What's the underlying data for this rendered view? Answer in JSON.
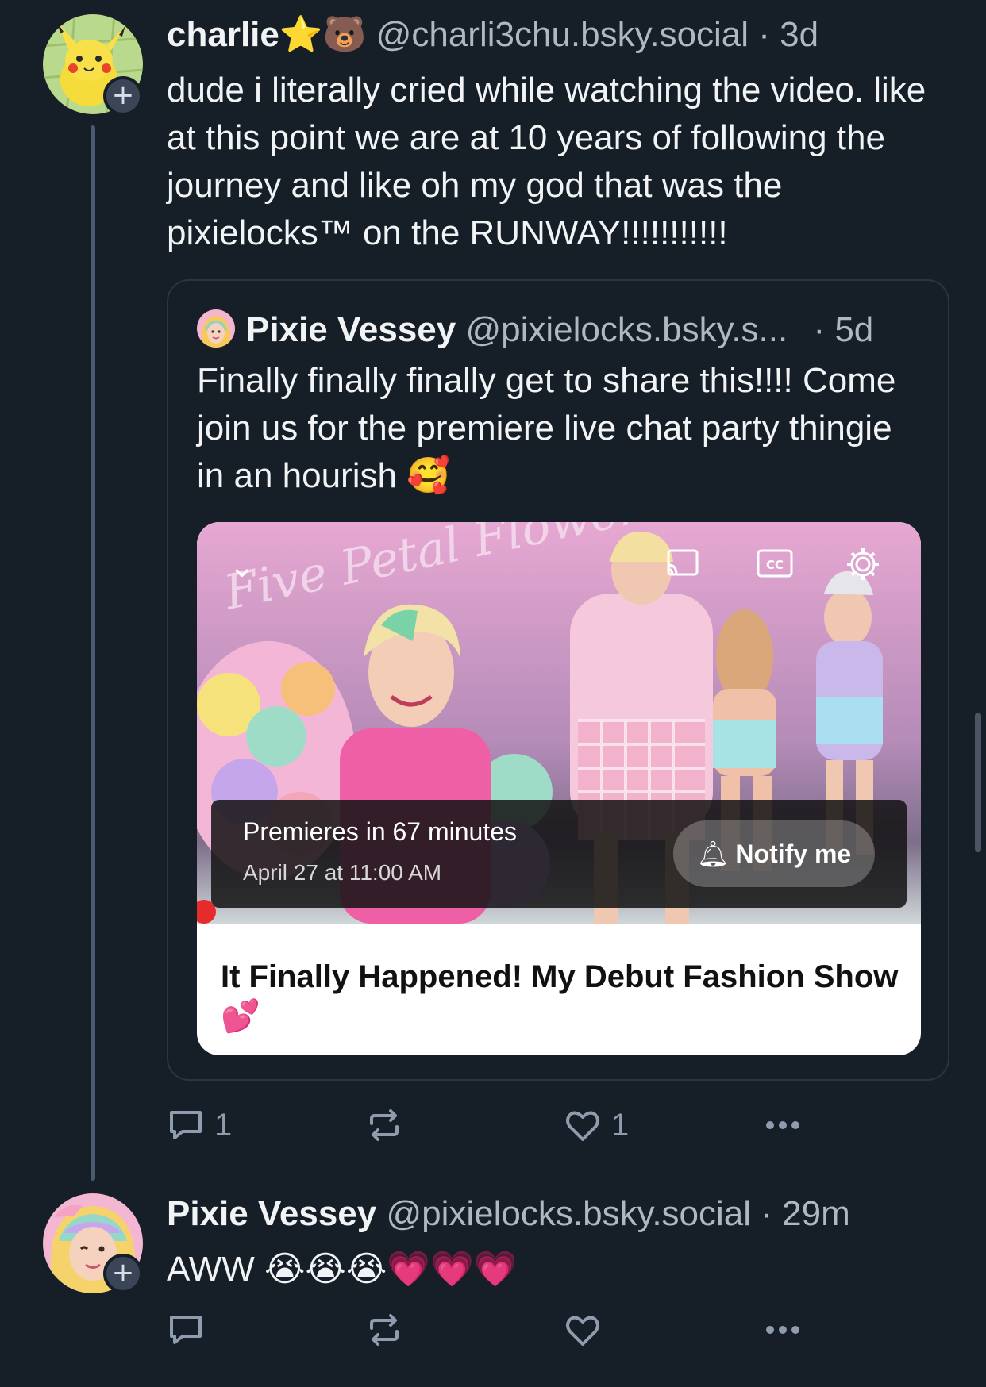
{
  "post1": {
    "display_name": "charlie",
    "name_emoji": "⭐🐻",
    "handle": "@charli3chu.bsky.social",
    "time": "· 3d",
    "text": "dude i literally cried while watching the video. like at this point we are at 10 years of following the journey and like oh my god that was the pixielocks™ on the RUNWAY!!!!!!!!!!!",
    "avatar_icon": "pikachu-avatar",
    "actions": {
      "reply_count": "1",
      "repost_count": "",
      "like_count": "1"
    }
  },
  "quote": {
    "display_name": "Pixie Vessey",
    "handle": "@pixielocks.bsky.s...",
    "time": "· 5d",
    "text": "Finally finally finally get to share this!!!! Come join us for the premiere live chat party thingie in an hourish 🥰",
    "embed": {
      "premiere_text": "Premieres in 67 minutes",
      "premiere_date": "April 27 at 11:00 AM",
      "notify_label": "Notify me",
      "video_title": "It Finally Happened! My Debut Fashion Show 💕",
      "icons": [
        "chevron-down-icon",
        "cast-icon",
        "cc-icon",
        "settings-icon",
        "bell-icon"
      ]
    }
  },
  "post2": {
    "display_name": "Pixie Vessey",
    "handle": "@pixielocks.bsky.social",
    "time": "· 29m",
    "text": "AWW 😭😭😭💗💗💗",
    "avatar_icon": "rainbow-hair-avatar"
  },
  "colors": {
    "background": "#161e27",
    "muted_text": "#aeb8c5",
    "thread_line": "#4a5a70"
  }
}
